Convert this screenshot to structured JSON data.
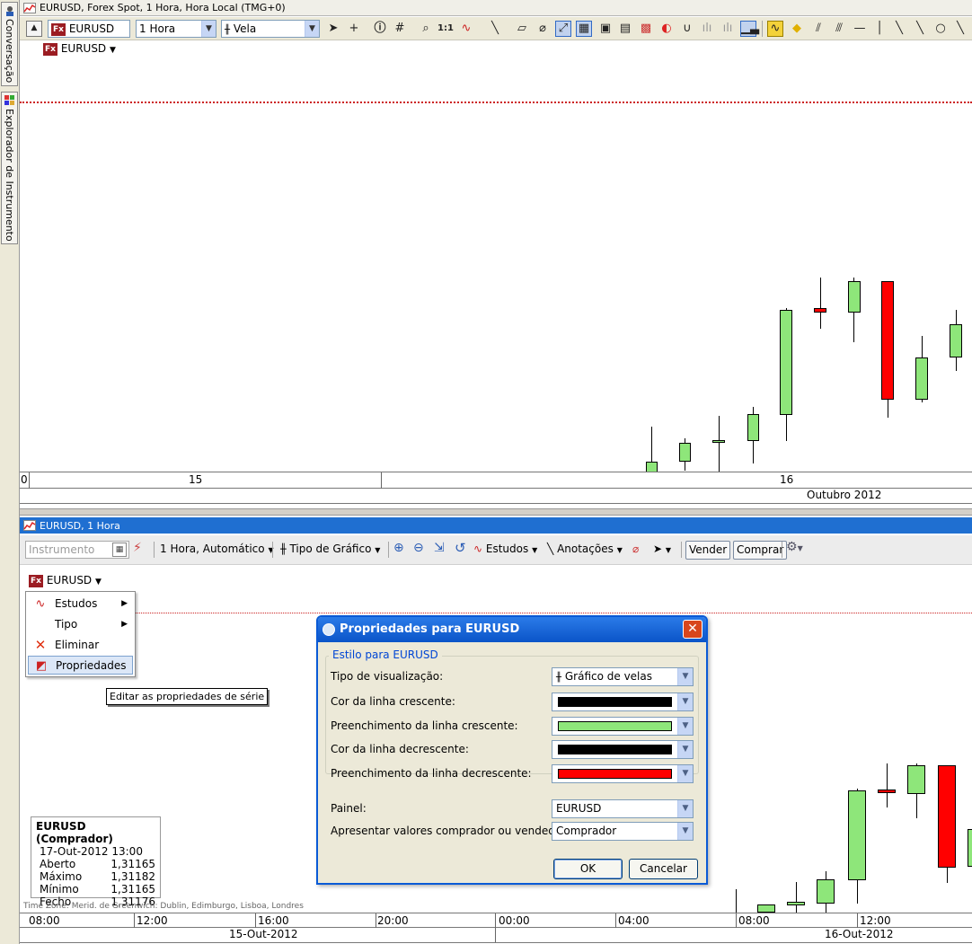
{
  "side_tabs": {
    "chat_label": "Conversação",
    "explorer_label": "Explorador de Instrumento"
  },
  "top_window": {
    "title": "EURUSD, Forex Spot, 1 Hora, Hora Local (TMG+0)",
    "instrument_value": "EURUSD",
    "period_value": "1 Hora",
    "chart_type_value": "Vela",
    "instrument_label": "EURUSD",
    "fx_badge": "Fx",
    "axis": {
      "left_label": "0",
      "day_label_1": "15",
      "day_label_2": "16",
      "month_label": "Outubro 2012"
    }
  },
  "bottom_window": {
    "title": "EURUSD, 1 Hora",
    "toolbar": {
      "instrument_placeholder": "Instrumento",
      "period": "1 Hora,  Automático",
      "chart_type": "Tipo de Gráfico",
      "studies": "Estudos",
      "annotations": "Anotações",
      "sell": "Vender",
      "buy": "Comprar"
    },
    "instrument_label": "EURUSD",
    "context_menu": {
      "items": [
        {
          "label": "Estudos",
          "icon": "studies-icon"
        },
        {
          "label": "Tipo",
          "icon": "type-icon"
        },
        {
          "label": "Eliminar",
          "icon": "delete-icon"
        },
        {
          "label": "Propriedades",
          "icon": "properties-icon"
        }
      ]
    },
    "tooltip": "Editar as propriedades de série",
    "info_box": {
      "title": "EURUSD (Comprador)",
      "date": "17-Out-2012 13:00",
      "rows": [
        {
          "label": "Aberto",
          "value": "1,31165"
        },
        {
          "label": "Máximo",
          "value": "1,31182"
        },
        {
          "label": "Mínimo",
          "value": "1,31165"
        },
        {
          "label": "Fecho",
          "value": "1,31176"
        }
      ]
    },
    "timezone": "Time Zone: Merid. de Greenwich: Dublin, Edimburgo, Lisboa, Londres",
    "time_labels": [
      "08:00",
      "12:00",
      "16:00",
      "20:00",
      "00:00",
      "04:00",
      "08:00",
      "12:00"
    ],
    "date_labels": [
      "15-Out-2012",
      "16-Out-2012"
    ]
  },
  "dialog": {
    "title": "Propriedades para EURUSD",
    "group_title": "Estilo para EURUSD",
    "fields": {
      "view_type_label": "Tipo de visualização:",
      "view_type_value": "Gráfico de velas",
      "up_line_color_label": "Cor da linha crescente:",
      "up_fill_label": "Preenchimento da linha crescente:",
      "down_line_color_label": "Cor da linha decrescente:",
      "down_fill_label": "Preenchimento da linha decrescente:",
      "panel_label": "Painel:",
      "panel_value": "EURUSD",
      "bid_ask_label": "Apresentar valores comprador ou vendedor:",
      "bid_ask_value": "Comprador"
    },
    "colors": {
      "up_line": "#000000",
      "up_fill": "#8ee67a",
      "down_line": "#000000",
      "down_fill": "#ff0000"
    },
    "ok": "OK",
    "cancel": "Cancelar"
  }
}
